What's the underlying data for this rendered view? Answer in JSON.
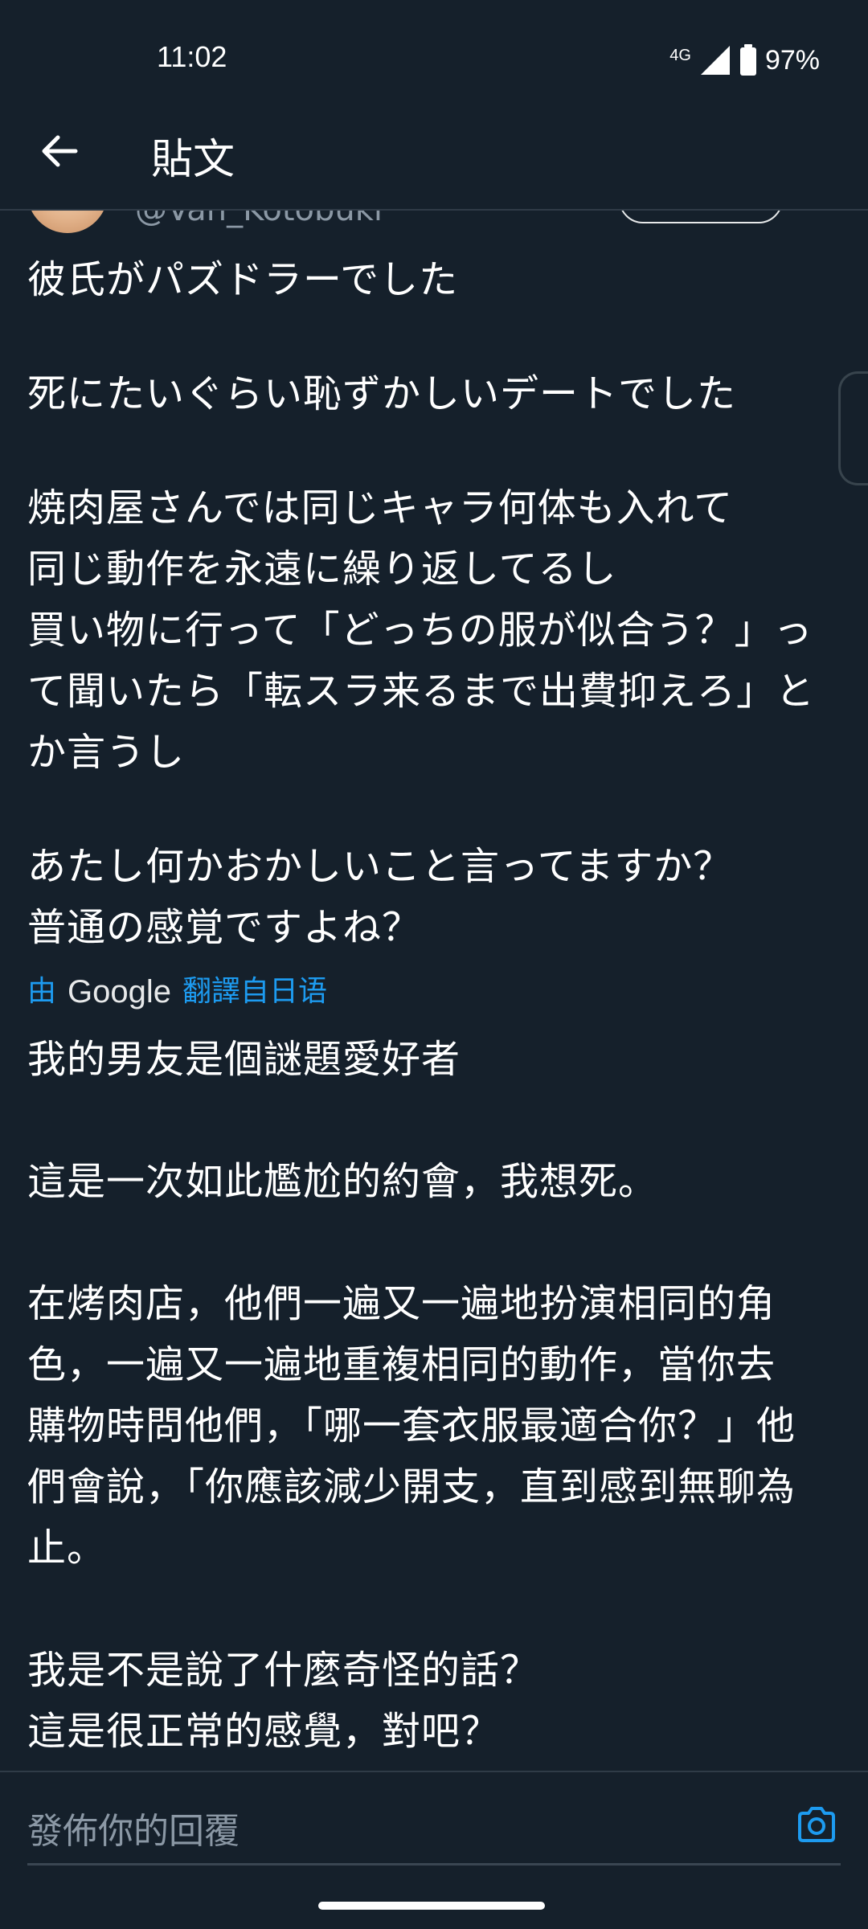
{
  "status_bar": {
    "time": "11:02",
    "network": "4G",
    "battery": "97%"
  },
  "header": {
    "title": "貼文"
  },
  "tweet": {
    "handle": "@Van_Kotobuki",
    "original_text": [
      "彼氏がパズドラーでした",
      "死にたいぐらい恥ずかしいデートでした",
      "焼肉屋さんでは同じキャラ何体も入れて\n同じ動作を永遠に繰り返してるし\n買い物に行って「どっちの服が似合う？」っ\nて聞いたら「転スラ来るまで出費抑えろ」と\nか言うし",
      "あたし何かおかしいこと言ってますか？\n普通の感覚ですよね？"
    ],
    "translation_note": {
      "prefix": "由",
      "provider": "Google",
      "suffix": "翻譯自日语"
    },
    "translated_text": [
      "我的男友是個謎題愛好者",
      "這是一次如此尷尬的約會，我想死。",
      "在烤肉店，他們一遍又一遍地扮演相同的角\n色，一遍又一遍地重複相同的動作，當你去\n購物時問他們，「哪一套衣服最適合你？」他\n們會說，「你應該減少開支，直到感到無聊為\n止。",
      "我是不是說了什麼奇怪的話？\n這是很正常的感覺，對吧？"
    ]
  },
  "reply": {
    "placeholder": "發佈你的回覆"
  },
  "colors": {
    "background": "#15202b",
    "accent": "#1d9bf0",
    "muted": "#8b98a5"
  }
}
